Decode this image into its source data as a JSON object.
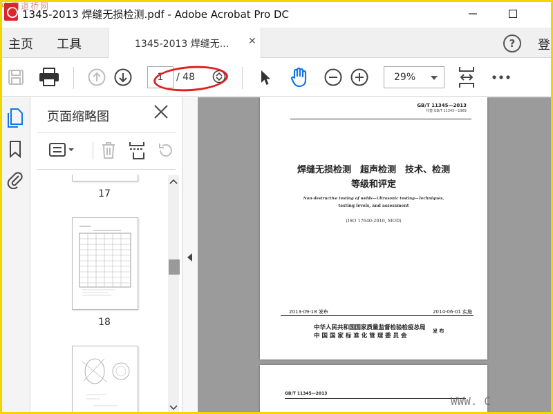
{
  "window": {
    "title": "1345-2013 焊缝无损检测.pdf - Adobe Acrobat Pro DC",
    "watermark_top": "中国道桥网",
    "watermark_bottom": "WWW. C"
  },
  "menu": {
    "home": "主页",
    "tools": "工具",
    "tab_label": "1345-2013 焊缝无...",
    "sign_in": "登",
    "help": "?"
  },
  "toolbar": {
    "current_page": "1",
    "page_total": "/ 48",
    "zoom": "29%"
  },
  "thumbnails": {
    "title": "页面缩略图",
    "pages": [
      {
        "number": "17"
      },
      {
        "number": "18"
      }
    ]
  },
  "document": {
    "page1": {
      "std_code": "GB/T 11345—2013",
      "replaces": "代替 GB/T 11345—1989",
      "title_line1": "焊缝无损检测　超声检测　技术、检测",
      "title_line2": "等级和评定",
      "en_title_line1": "Non-destructive testing of welds—Ultrasonic testing—Techniques,",
      "en_title_line2": "testing levels, and assessment",
      "iso_ref": "(ISO 17640:2010, MOD)",
      "issue_date": "2013-09-18 发布",
      "impl_date": "2014-06-01 实施",
      "issuer1": "中华人民共和国国家质量监督检验检疫总局",
      "issuer2": "中 国 国 家 标 准 化 管 理 委 员 会",
      "publish": "发 布"
    },
    "page2": {
      "std_code": "GB/T 11345—2013"
    }
  },
  "colors": {
    "frame": "#f2d600",
    "annotation": "#e02020",
    "hand_tool": "#1473e6",
    "doc_bg": "#9b9b9b"
  }
}
